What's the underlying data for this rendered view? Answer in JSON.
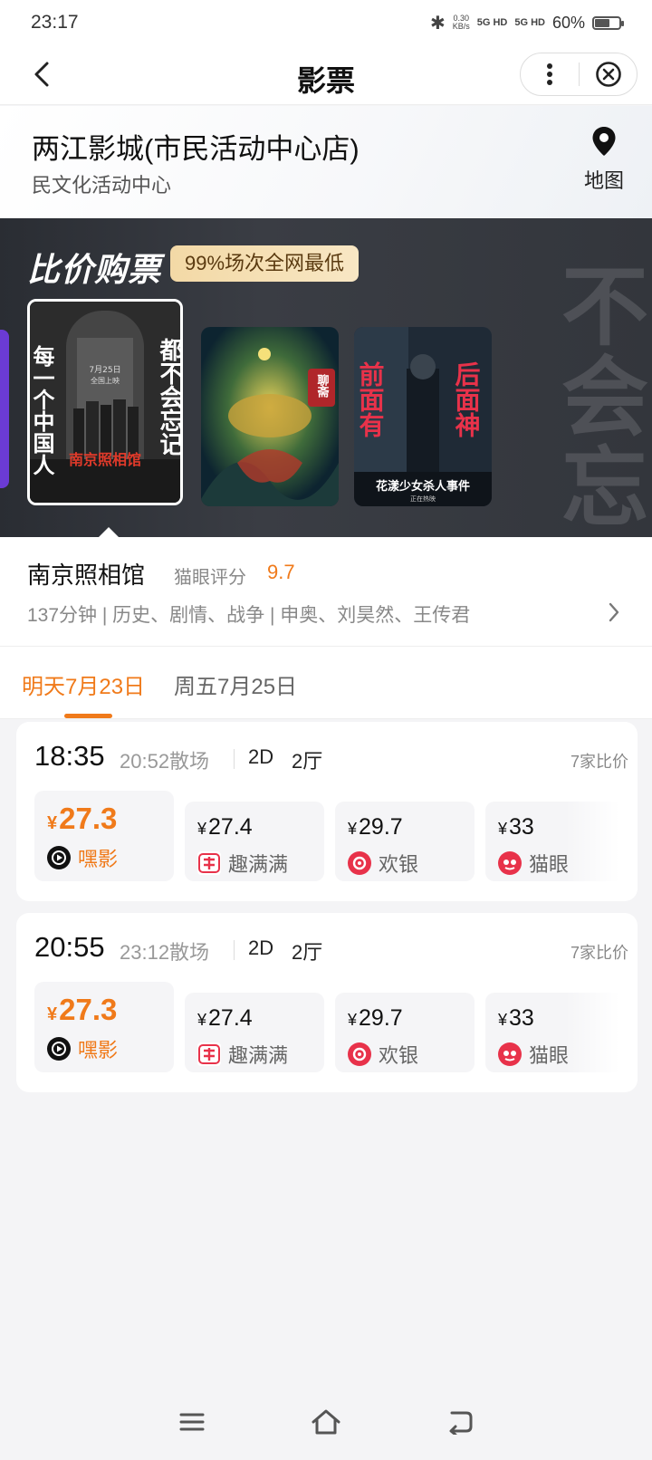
{
  "status_bar": {
    "time": "23:17",
    "net_speed_value": "0.30",
    "net_speed_unit": "KB/s",
    "signal1": "5G HD",
    "signal2": "5G HD",
    "battery": "60%",
    "icons": [
      "bluetooth-icon",
      "signal-icon",
      "battery-icon"
    ]
  },
  "nav": {
    "title": "影票",
    "icons": [
      "back-icon",
      "more-icon",
      "close-icon"
    ]
  },
  "cinema": {
    "name": "两江影城(市民活动中心店)",
    "address": "民文化活动中心",
    "map_label": "地图",
    "icon": "location-pin-icon"
  },
  "promo": {
    "title": "比价购票",
    "badge": "99%场次全网最低",
    "background_chars": [
      "不",
      "会",
      "忘"
    ],
    "posters": [
      {
        "name": "南京照相馆",
        "left_text": "每一个中国人",
        "right_text": "都不会忘记",
        "logo_text": "南京照相馆",
        "date_text": "7月25日",
        "release_text": "全国上映",
        "selected": true
      },
      {
        "name": "聊斋",
        "seal_text": "聊斋"
      },
      {
        "name": "前面有鬼后面有神",
        "left_text": "前面有",
        "right_text": "后面神",
        "bottom_text": "花漾少女杀人事件",
        "sub_text": "正在热映"
      }
    ]
  },
  "movie": {
    "title": "南京照相馆",
    "rating_label": "猫眼评分",
    "rating": "9.7",
    "meta": "137分钟 | 历史、剧情、战争 | 申奥、刘昊然、王传君"
  },
  "date_tabs": [
    {
      "label": "明天7月23日",
      "active": true
    },
    {
      "label": "周五7月25日",
      "active": false
    }
  ],
  "showtimes": [
    {
      "start": "18:35",
      "end": "20:52散场",
      "format": "2D",
      "hall": "2厅",
      "compare": "7家比价",
      "prices": [
        {
          "symbol": "¥",
          "price": "27.3",
          "platform": "嘿影",
          "best": true,
          "icon": "heiying-icon"
        },
        {
          "symbol": "¥",
          "price": "27.4",
          "platform": "趣满满",
          "best": false,
          "icon": "qumanman-icon"
        },
        {
          "symbol": "¥",
          "price": "29.7",
          "platform": "欢银",
          "best": false,
          "icon": "huanyin-icon"
        },
        {
          "symbol": "¥",
          "price": "33",
          "platform": "猫眼",
          "best": false,
          "icon": "maoyan-icon"
        }
      ]
    },
    {
      "start": "20:55",
      "end": "23:12散场",
      "format": "2D",
      "hall": "2厅",
      "compare": "7家比价",
      "prices": [
        {
          "symbol": "¥",
          "price": "27.3",
          "platform": "嘿影",
          "best": true,
          "icon": "heiying-icon"
        },
        {
          "symbol": "¥",
          "price": "27.4",
          "platform": "趣满满",
          "best": false,
          "icon": "qumanman-icon"
        },
        {
          "symbol": "¥",
          "price": "29.7",
          "platform": "欢银",
          "best": false,
          "icon": "huanyin-icon"
        },
        {
          "symbol": "¥",
          "price": "33",
          "platform": "猫眼",
          "best": false,
          "icon": "maoyan-icon"
        }
      ]
    }
  ],
  "colors": {
    "accent": "#f07a1a",
    "background": "#f4f4f6",
    "badge": "#f3d9a6",
    "band": "#33363c"
  },
  "system_nav": {
    "icons": [
      "menu-icon",
      "home-icon",
      "back-nav-icon"
    ]
  }
}
